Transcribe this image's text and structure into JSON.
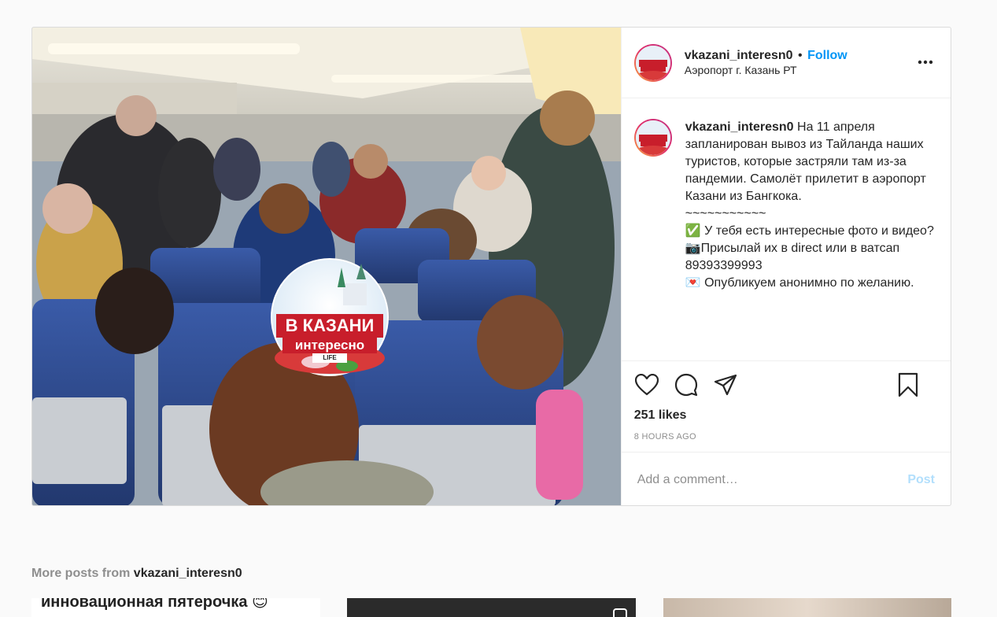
{
  "post": {
    "username": "vkazani_interesn0",
    "separator": "•",
    "follow_label": "Follow",
    "location": "Аэропорт г. Казань РТ",
    "more_icon": "more-horizontal-icon",
    "caption": {
      "username": "vkazani_interesn0",
      "text": " На 11 апреля запланирован вывоз из Тайланда наших туристов, которые застряли там из-за пандемии. Самолёт прилетит в аэропорт Казани из Бангкока.\n~~~~~~~~~~~\n✅ У тебя есть интересные фото и видео?\n📷Присылай их в direct или в ватсап 89393399993\n💌 Опубликуем анонимно по желанию."
    },
    "likes": "251 likes",
    "time": "8 HOURS AGO",
    "comment_placeholder": "Add a comment…",
    "post_label": "Post",
    "photo_logo": {
      "line1": "В КАЗАНИ",
      "line2": "интересно",
      "line3": "LIFE"
    },
    "colors": {
      "follow": "#0095f6",
      "post_disabled": "#b2dffc",
      "seat_blue": "#2c4a8c"
    }
  },
  "more_posts": {
    "prefix": "More posts from ",
    "username": "vkazani_interesn0",
    "thumb1_text": "инновационная пятерочка 😊"
  }
}
